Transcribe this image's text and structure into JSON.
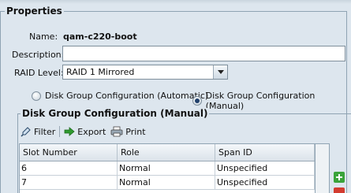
{
  "properties": {
    "legend": "Properties",
    "name_label": "Name:",
    "name_value": "qam-c220-boot",
    "description_label": "Description:",
    "description_value": "",
    "raid_label": "RAID Level:",
    "raid_value": "RAID 1 Mirrored",
    "radio_automatic": "Disk Group Configuration (Automatic)",
    "radio_manual": "Disk Group Configuration (Manual)",
    "selected_radio": "manual"
  },
  "disk_group": {
    "legend": "Disk Group Configuration (Manual)",
    "toolbar": {
      "filter": "Filter",
      "export": "Export",
      "print": "Print"
    },
    "columns": [
      "Slot Number",
      "Role",
      "Span ID"
    ],
    "rows": [
      [
        "6",
        "Normal",
        "Unspecified"
      ],
      [
        "7",
        "Normal",
        "Unspecified"
      ]
    ]
  },
  "colors": {
    "background": "#dde6ee",
    "add_button": "#3aa33a",
    "delete_button": "#d33b2f"
  },
  "icons": [
    "filter-icon",
    "export-icon",
    "print-icon",
    "column-chooser-icon",
    "add-icon",
    "delete-icon"
  ]
}
